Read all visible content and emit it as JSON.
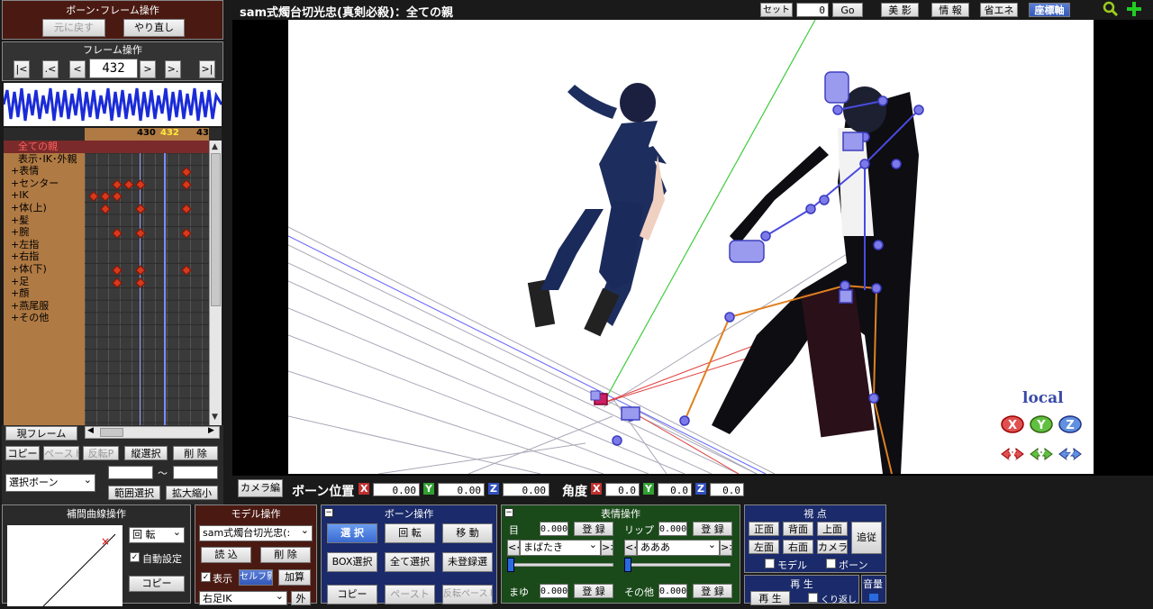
{
  "left_top": {
    "title": "ボーン･フレーム操作",
    "undo": "元に戻す",
    "redo": "やり直し"
  },
  "frame_op": {
    "title": "フレーム操作",
    "btn_first": "|<",
    "btn_prev_key": ".<",
    "btn_prev": "<",
    "frame": "432",
    "btn_next": ">",
    "btn_next_key": ">.",
    "btn_last": ">|"
  },
  "timeline": {
    "ruler": [
      "430",
      "432",
      "43"
    ],
    "rows": [
      "全ての親",
      "表示･IK･外親",
      "+表情",
      "+センター",
      "+IK",
      "+体(上)",
      "+髪",
      "+腕",
      "+左指",
      "+右指",
      "+体(下)",
      "+足",
      "+顔",
      "+燕尾服",
      "+その他"
    ],
    "current_frame_btn": "現フレーム",
    "copy": "コピー",
    "paste": "ペースト",
    "reverse": "反転P",
    "vsel": "縦選択",
    "del": "削 除",
    "sel_bone": "選択ボーン",
    "range_sel": "範囲選択",
    "scale": "拡大縮小",
    "tilde": "～"
  },
  "viewport": {
    "title": "sam式燭台切光忠(真剣必殺)：全ての親",
    "set": "セット",
    "set_val": "0",
    "go": "Go",
    "bishadow": "美 影",
    "info": "情 報",
    "eco": "省エネ",
    "axis": "座標軸",
    "local": "local"
  },
  "pos_bar": {
    "camera": "カメラ編",
    "bone_pos": "ボーン位置",
    "x": "0.00",
    "y": "0.00",
    "z": "0.00",
    "angle": "角度",
    "ax": "0.0",
    "ay": "0.0",
    "az": "0.0",
    "X": "X",
    "Y": "Y",
    "Z": "Z"
  },
  "interp": {
    "title": "補間曲線操作",
    "rot": "回 転",
    "auto": "自動設定",
    "copy": "コピー"
  },
  "model": {
    "title": "モデル操作",
    "model_name": "sam式燭台切光忠(:",
    "load": "読 込",
    "del": "削 除",
    "show": "表示",
    "self": "セルフ影",
    "add": "加算",
    "bone_sel": "右足IK",
    "ext": "外"
  },
  "bone_ops": {
    "title": "ボーン操作",
    "sel": "選 択",
    "rot": "回 転",
    "move": "移 動",
    "box": "BOX選択",
    "all": "全て選択",
    "unreg": "未登録選",
    "copy": "コピー",
    "paste": "ペースト",
    "rev": "反転ペースト"
  },
  "face": {
    "title": "表情操作",
    "eye": "目",
    "eye_val": "0.000",
    "reg": "登 録",
    "lip": "リップ",
    "lip_val": "0.000",
    "eye_sel": "まばたき",
    "lip_sel": "あああ",
    "brow": "まゆ",
    "brow_val": "0.000",
    "other": "その他",
    "other_val": "0.000"
  },
  "view": {
    "title": "視 点",
    "front": "正面",
    "back": "背面",
    "top": "上面",
    "follow": "追従",
    "left": "左面",
    "right": "右面",
    "camera": "カメラ",
    "model": "モデル",
    "bone": "ボーン"
  },
  "play": {
    "title": "再 生",
    "play": "再 生",
    "loop": "くり返し",
    "vol": "音量"
  }
}
